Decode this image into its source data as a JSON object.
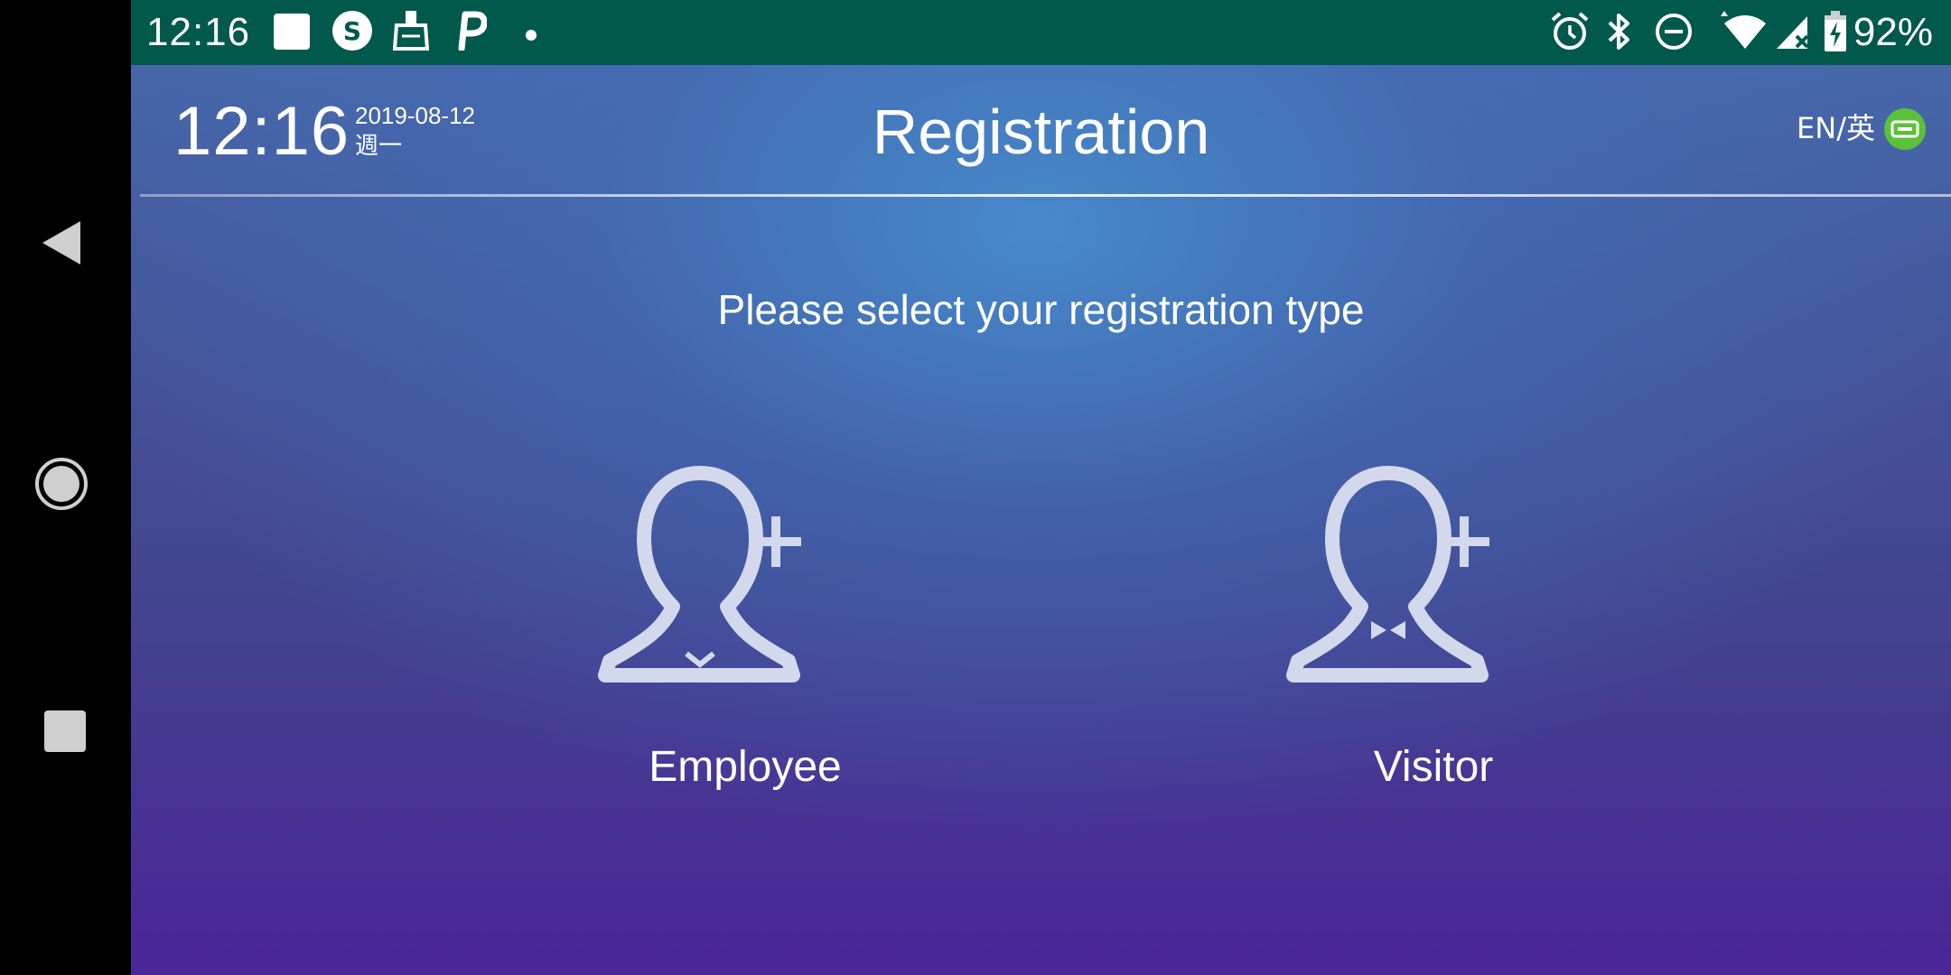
{
  "status_bar": {
    "time": "12:16",
    "battery_percent": "92%",
    "left_icons": [
      "image-icon",
      "s-app-icon",
      "cleaner-icon",
      "p-app-icon",
      "dot-icon"
    ],
    "right_icons": [
      "alarm-icon",
      "bluetooth-icon",
      "dnd-icon",
      "wifi-icon",
      "signal-icon",
      "battery-charging-icon"
    ],
    "background_color": "#00594b"
  },
  "navigation_bar": {
    "icons": [
      "back-icon",
      "home-icon",
      "recents-icon"
    ]
  },
  "header": {
    "time": "12:16",
    "date": "2019-08-12",
    "weekday": "週一",
    "title": "Registration",
    "language_toggle": "EN/英",
    "language_badge_color": "#5cc13a"
  },
  "main": {
    "prompt": "Please select your registration type",
    "options": [
      {
        "label": "Employee",
        "icon": "add-employee-icon"
      },
      {
        "label": "Visitor",
        "icon": "add-visitor-icon"
      }
    ]
  }
}
